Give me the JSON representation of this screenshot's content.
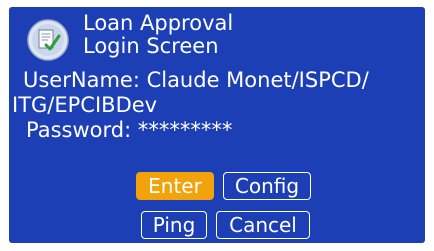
{
  "header": {
    "icon": "loan-approval-app-icon",
    "title_line1": "Loan Approval",
    "title_line2": "Login Screen"
  },
  "fields": {
    "username_line1": "UserName: Claude Monet/ISPCD/",
    "username_line2": "ITG/EPCIBDev",
    "password": "Password: *********"
  },
  "buttons": {
    "enter": "Enter",
    "config": "Config",
    "ping": "Ping",
    "cancel": "Cancel",
    "focused": "enter"
  },
  "colors": {
    "panel_background": "#1c3fb6",
    "focus_highlight": "#f2a20a",
    "text": "#ffffff"
  }
}
